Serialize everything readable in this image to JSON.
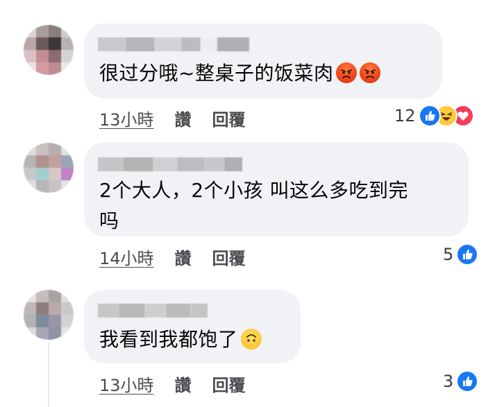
{
  "comments": [
    {
      "text_line1": "很过分哦~整桌子的饭菜肉",
      "text_line2": "",
      "emoji": [
        "angry-face-emoji",
        "angry-face-emoji"
      ],
      "time": "13小時",
      "like_label": "讚",
      "reply_label": "回覆",
      "reaction_count": "12",
      "reactions": [
        "like",
        "haha",
        "love"
      ]
    },
    {
      "text_line1": "2个大人，2个小孩 叫这么多吃到完",
      "text_line2": "吗",
      "emoji": [],
      "time": "14小時",
      "like_label": "讚",
      "reply_label": "回覆",
      "reaction_count": "5",
      "reactions": [
        "like"
      ]
    },
    {
      "text_line1": "我看到我都饱了",
      "text_line2": "",
      "emoji": [
        "upside-down-face-emoji"
      ],
      "time": "13小時",
      "like_label": "讚",
      "reply_label": "回覆",
      "reaction_count": "3",
      "reactions": [
        "like"
      ]
    }
  ],
  "colors": {
    "bubble": "#f0f2f5",
    "like": "#1877f2",
    "haha": "#ffcb3d",
    "love": "#f33e58",
    "angry": "#ee4419",
    "meta_text": "#4b4c4f"
  }
}
